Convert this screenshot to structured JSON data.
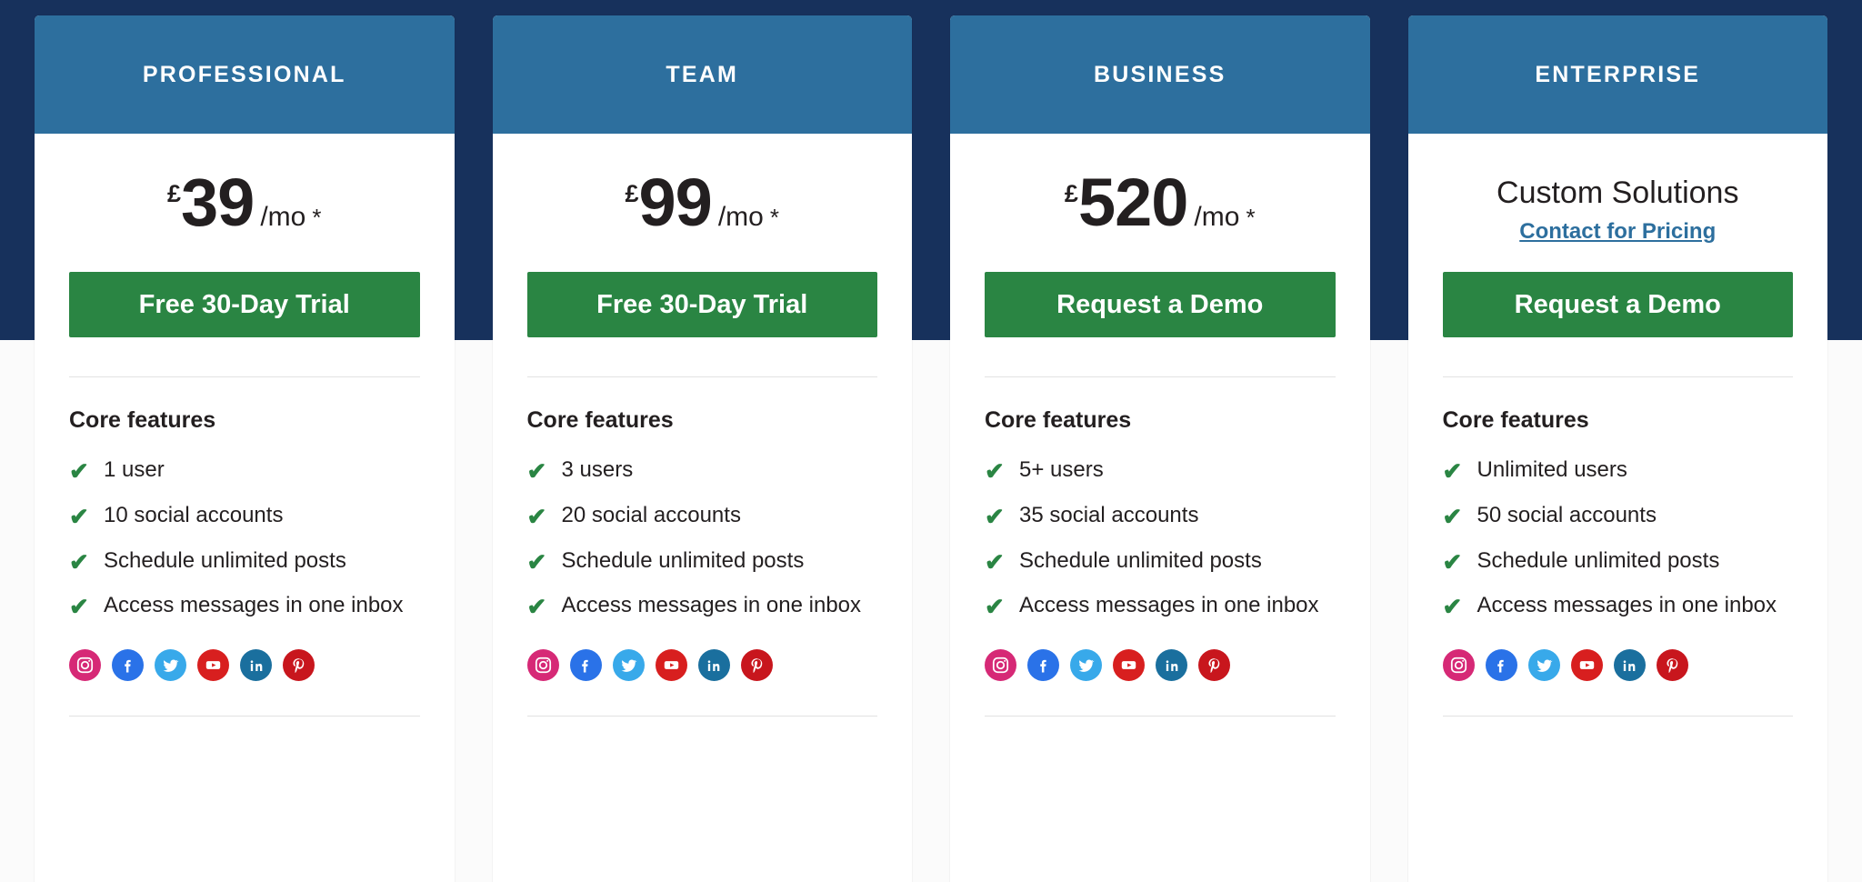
{
  "colors": {
    "page_navy": "#17315c",
    "card_header_blue": "#2d6f9e",
    "cta_green": "#2a8543",
    "check_green": "#2a8543",
    "link_blue": "#2d6f9e",
    "text_dark": "#231f20",
    "card_white": "#ffffff",
    "divider": "#e2e2e2"
  },
  "social": [
    {
      "name": "instagram-icon",
      "label": "Instagram",
      "color": "#d62976"
    },
    {
      "name": "facebook-icon",
      "label": "Facebook",
      "color": "#2a72e8"
    },
    {
      "name": "twitter-icon",
      "label": "Twitter",
      "color": "#38a9ea"
    },
    {
      "name": "youtube-icon",
      "label": "YouTube",
      "color": "#d81f1f"
    },
    {
      "name": "linkedin-icon",
      "label": "LinkedIn",
      "color": "#1a6f9e"
    },
    {
      "name": "pinterest-icon",
      "label": "Pinterest",
      "color": "#c8161d"
    }
  ],
  "features_heading": "Core features",
  "check_glyph": "✔",
  "plans": [
    {
      "id": "professional",
      "name": "PROFESSIONAL",
      "price_type": "amount",
      "currency": "£",
      "amount": "39",
      "period": "/mo",
      "asterisk": "*",
      "cta_label": "Free 30-Day Trial",
      "features_heading": "Core features",
      "features": [
        "1 user",
        "10 social accounts",
        "Schedule unlimited posts",
        "Access messages in one inbox"
      ]
    },
    {
      "id": "team",
      "name": "TEAM",
      "price_type": "amount",
      "currency": "£",
      "amount": "99",
      "period": "/mo",
      "asterisk": "*",
      "cta_label": "Free 30-Day Trial",
      "features_heading": "Core features",
      "features": [
        "3 users",
        "20 social accounts",
        "Schedule unlimited posts",
        "Access messages in one inbox"
      ]
    },
    {
      "id": "business",
      "name": "BUSINESS",
      "price_type": "amount",
      "currency": "£",
      "amount": "520",
      "period": "/mo",
      "asterisk": "*",
      "cta_label": "Request a Demo",
      "features_heading": "Core features",
      "features": [
        "5+ users",
        "35 social accounts",
        "Schedule unlimited posts",
        "Access messages in one inbox"
      ]
    },
    {
      "id": "enterprise",
      "name": "ENTERPRISE",
      "price_type": "custom",
      "custom_title": "Custom Solutions",
      "custom_link": "Contact for Pricing",
      "cta_label": "Request a Demo",
      "features_heading": "Core features",
      "features": [
        "Unlimited users",
        "50 social accounts",
        "Schedule unlimited posts",
        "Access messages in one inbox"
      ]
    }
  ]
}
